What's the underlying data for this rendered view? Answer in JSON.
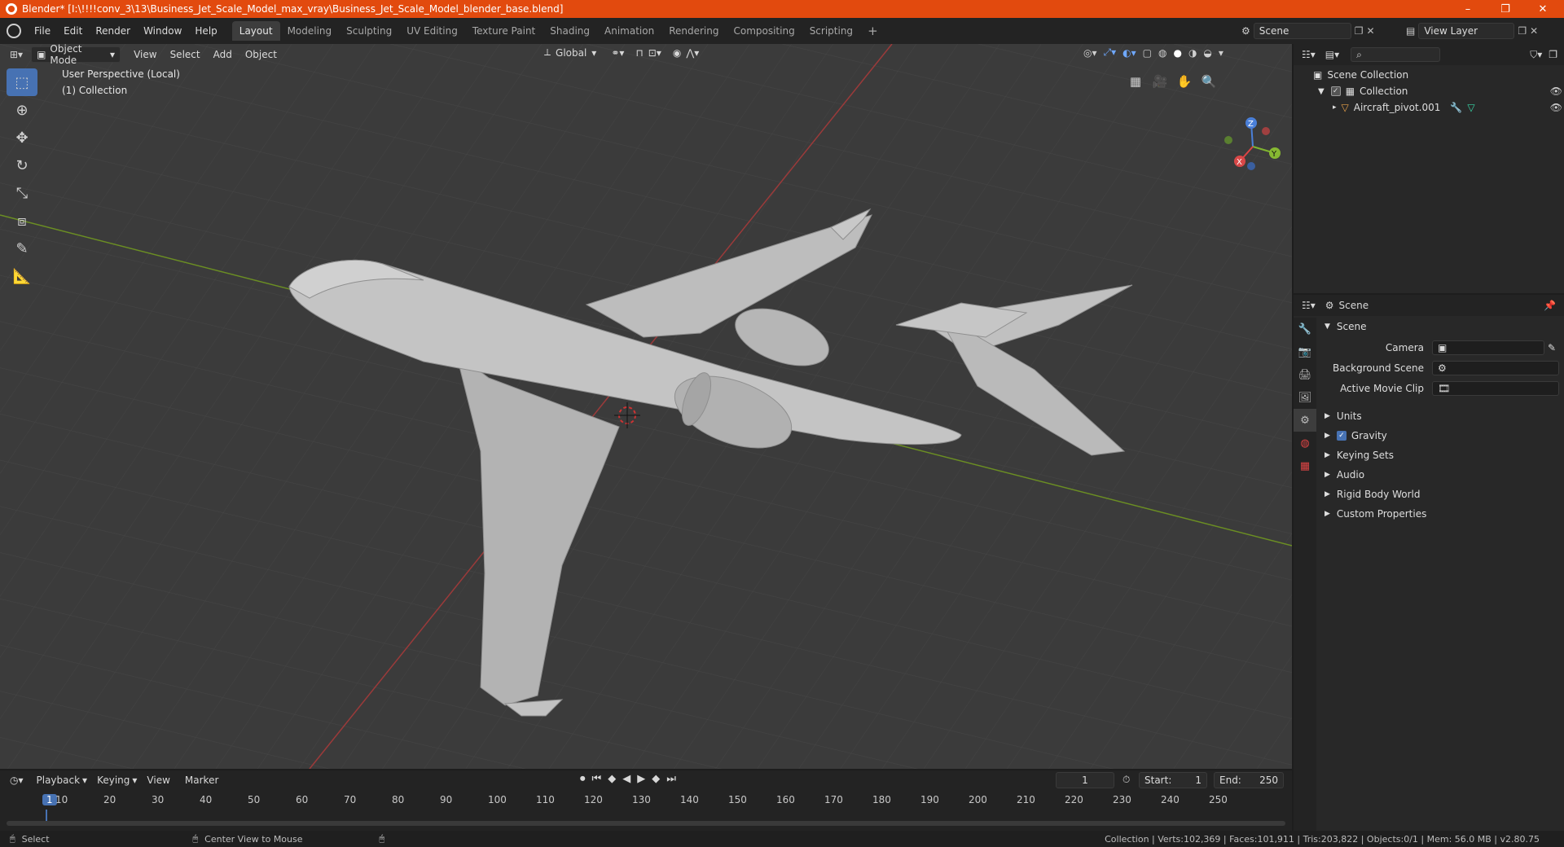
{
  "window": {
    "title": "Blender* [I:\\!!!!conv_3\\13\\Business_Jet_Scale_Model_max_vray\\Business_Jet_Scale_Model_blender_base.blend]",
    "min_glyph": "–",
    "max_glyph": "❐",
    "close_glyph": "✕"
  },
  "menu": [
    "File",
    "Edit",
    "Render",
    "Window",
    "Help"
  ],
  "workspaces": [
    "Layout",
    "Modeling",
    "Sculpting",
    "UV Editing",
    "Texture Paint",
    "Shading",
    "Animation",
    "Rendering",
    "Compositing",
    "Scripting"
  ],
  "active_workspace": "Layout",
  "add_tab_glyph": "+",
  "scene_field": "Scene",
  "view_layer_field": "View Layer",
  "viewport": {
    "mode": "Object Mode",
    "menus": [
      "View",
      "Select",
      "Add",
      "Object"
    ],
    "transform_orientation": "Global",
    "overlay_line1": "User Perspective (Local)",
    "overlay_line2": "(1) Collection",
    "gizmo": {
      "x": "X",
      "y": "Y",
      "z": "Z"
    }
  },
  "outliner": {
    "root": "Scene Collection",
    "collection": "Collection",
    "object": "Aircraft_pivot.001"
  },
  "properties": {
    "context": "Scene",
    "panel": "Scene",
    "fields": [
      {
        "label": "Camera",
        "value": ""
      },
      {
        "label": "Background Scene",
        "value": ""
      },
      {
        "label": "Active Movie Clip",
        "value": ""
      }
    ],
    "sections": [
      "Units",
      "Gravity",
      "Keying Sets",
      "Audio",
      "Rigid Body World",
      "Custom Properties"
    ],
    "gravity_checked": true
  },
  "timeline": {
    "menus": [
      "Playback",
      "Keying",
      "View",
      "Marker"
    ],
    "current_frame": "1",
    "start_label": "Start:",
    "start": "1",
    "end_label": "End:",
    "end": "250",
    "ticks": [
      "1",
      "10",
      "20",
      "30",
      "40",
      "50",
      "60",
      "70",
      "80",
      "90",
      "100",
      "110",
      "120",
      "130",
      "140",
      "150",
      "160",
      "170",
      "180",
      "190",
      "200",
      "210",
      "220",
      "230",
      "240",
      "250"
    ]
  },
  "statusbar": {
    "left_action": "Select",
    "middle_action": "Center View to Mouse",
    "stats": "Collection | Verts:102,369 | Faces:101,911 | Tris:203,822 | Objects:0/1 | Mem: 56.0 MB | v2.80.75"
  }
}
